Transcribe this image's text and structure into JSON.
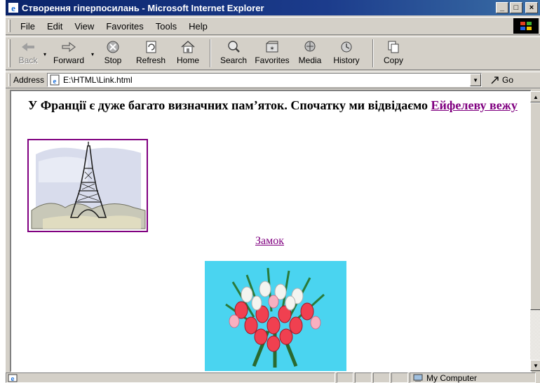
{
  "window": {
    "title": "Створення гіперпосилань - Microsoft Internet Explorer"
  },
  "menu": {
    "items": [
      {
        "label": "File"
      },
      {
        "label": "Edit"
      },
      {
        "label": "View"
      },
      {
        "label": "Favorites"
      },
      {
        "label": "Tools"
      },
      {
        "label": "Help"
      }
    ]
  },
  "toolbar": {
    "back": "Back",
    "forward": "Forward",
    "stop": "Stop",
    "refresh": "Refresh",
    "home": "Home",
    "search": "Search",
    "favorites": "Favorites",
    "media": "Media",
    "history": "History",
    "copy": "Copy"
  },
  "address": {
    "label": "Address",
    "value": "E:\\HTML\\Link.html",
    "go": "Go"
  },
  "content": {
    "paragraph": "У Франції є дуже багато визначних пам’яток. Спочатку ми відвідаємо",
    "eiffel_link": "Ейфелеву вежу",
    "castle_link": "Замок"
  },
  "status": {
    "zone": "My Computer"
  },
  "colors": {
    "title_bar": "#0a246a",
    "visited_link": "#800080",
    "chrome": "#d4d0c8",
    "flower_bg": "#4ad4f0"
  },
  "icons": {
    "app": "ie-icon",
    "back": "back-arrow-icon",
    "forward": "forward-arrow-icon",
    "stop": "stop-icon",
    "refresh": "refresh-icon",
    "home": "home-icon",
    "search": "search-icon",
    "favorites": "favorites-icon",
    "media": "media-icon",
    "history": "history-icon",
    "copy": "copy-icon",
    "go": "go-arrow-icon"
  }
}
